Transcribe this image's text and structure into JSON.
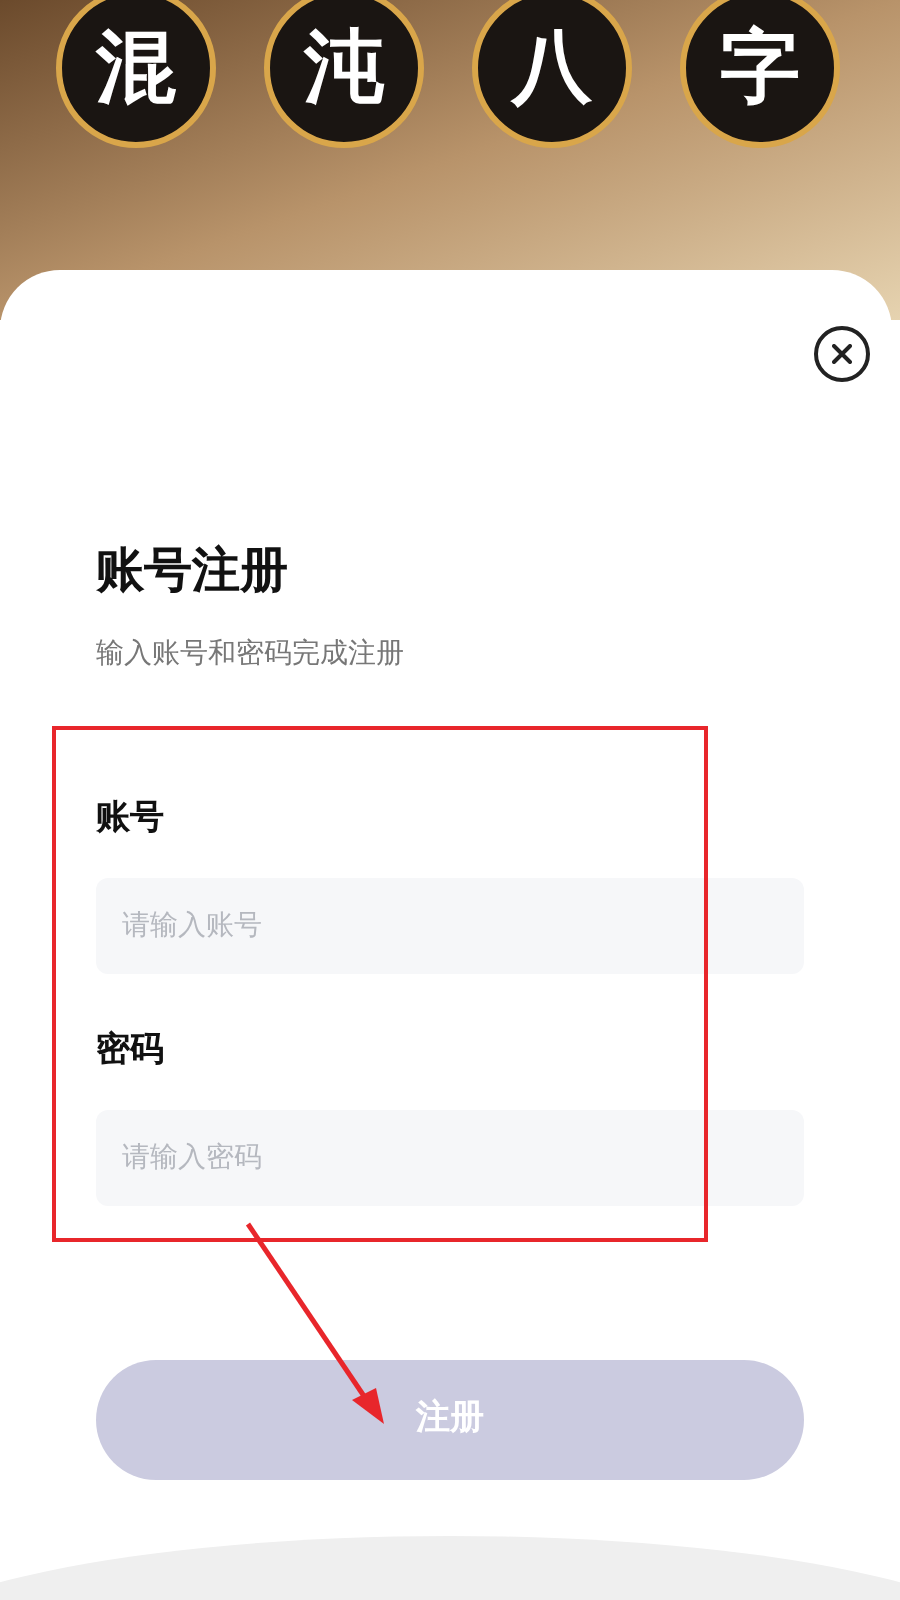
{
  "banner": {
    "title_chars": [
      "混",
      "沌",
      "八",
      "字"
    ]
  },
  "form": {
    "title": "账号注册",
    "subtitle": "输入账号和密码完成注册",
    "fields": [
      {
        "label": "账号",
        "placeholder": "请输入账号"
      },
      {
        "label": "密码",
        "placeholder": "请输入密码"
      }
    ],
    "submit": {
      "label": "注册",
      "disabled": true
    }
  }
}
